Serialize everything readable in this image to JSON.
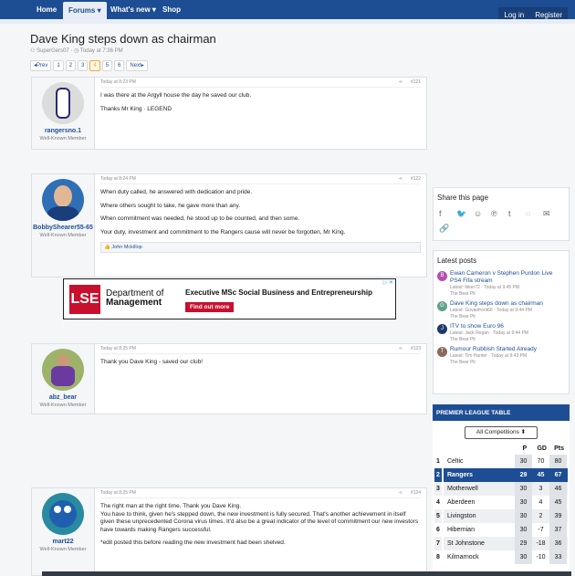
{
  "nav": {
    "home": "Home",
    "forums": "Forums",
    "whats_new": "What's new",
    "shop": "Shop",
    "login": "Log in",
    "register": "Register"
  },
  "thread": {
    "title": "Dave King steps down as chairman",
    "author": "SuperGers07",
    "date": "Today at 7:36 PM"
  },
  "pager": {
    "prev": "◂Prev",
    "pages": [
      "1",
      "2",
      "3",
      "4",
      "5",
      "6"
    ],
    "current": "4",
    "next": "Next▸"
  },
  "posts": [
    {
      "user": "rangersno.1",
      "title": "Well-Known Member",
      "time": "Today at 8:23 PM",
      "num": "#121",
      "body": [
        "I was there at the Argyll house the day he saved our club.",
        "Thanks Mr King · LEGEND"
      ]
    },
    {
      "user": "BobbyShearer55-65",
      "title": "Well-Known Member",
      "time": "Today at 8:24 PM",
      "num": "#122",
      "body": [
        "When duty called, he answered with dedication and pride.",
        "Where others sought to take, he gave more than any.",
        "When commitment was needed, he stood up to be counted, and then some.",
        "Your duty, investment and commitment to the Rangers cause will never be forgotten, Mr King."
      ],
      "likes": "John Mckillop"
    },
    {
      "user": "abz_bear",
      "title": "Well-Known Member",
      "time": "Today at 8:25 PM",
      "num": "#123",
      "body": [
        "Thank you Dave King - saved our club!"
      ]
    },
    {
      "user": "mart22",
      "title": "Well-Known Member",
      "time": "Today at 8:25 PM",
      "num": "#124",
      "body": [
        "The right man at the right time. Thank you Dave King.",
        "You have to think, given he's stepped down, the new investment is fully secured. That's another achievement in itself given these unprecedented Corona virus times. It'd also be a great indicator of the level of commitment our new investors have towards making Rangers successful.",
        "*edit posted this before reading the new investment had been shelved."
      ]
    }
  ],
  "ad": {
    "logo": "LSE",
    "dept1": "Department of",
    "dept2": "Management",
    "title": "Executive MSc Social Business and Entrepreneurship",
    "cta": "Find out more",
    "mark": "▷ ✕"
  },
  "share": {
    "title": "Share this page",
    "icons": [
      "facebook-icon",
      "twitter-icon",
      "reddit-icon",
      "pinterest-icon",
      "tumblr-icon",
      "whatsapp-icon",
      "email-icon",
      "link-icon"
    ]
  },
  "latest": {
    "title": "Latest posts",
    "items": [
      {
        "t": "Ewan Cameron v Stephen Purdon Live PS4 Fifa stream",
        "s": "Latest: biker72 · Today at 9:45 PM",
        "f": "The Bear Pit",
        "c": "#b44fb0",
        "i": "B"
      },
      {
        "t": "Dave King steps down as chairman",
        "s": "Latest: Govanfront66 · Today at 9:44 PM",
        "f": "The Bear Pit",
        "c": "#5fa28c",
        "i": "G"
      },
      {
        "t": "ITV to show Euro 96",
        "s": "Latest: Jack Regan · Today at 9:44 PM",
        "f": "The Bear Pit",
        "c": "#1d3a6e",
        "i": "J"
      },
      {
        "t": "Rumour Rubbish Started Already",
        "s": "Latest: Tim Hunter · Today at 9:43 PM",
        "f": "The Bear Pit",
        "c": "#8a6a5a",
        "i": "T"
      }
    ]
  },
  "table": {
    "title": "PREMIER LEAGUE TABLE",
    "select": "All Competitions",
    "cols": [
      "P",
      "GD",
      "Pts"
    ],
    "rows": [
      {
        "pos": "1",
        "team": "Celtic",
        "p": "30",
        "gd": "70",
        "pts": "80"
      },
      {
        "pos": "2",
        "team": "Rangers",
        "p": "29",
        "gd": "45",
        "pts": "67"
      },
      {
        "pos": "3",
        "team": "Motherwell",
        "p": "30",
        "gd": "3",
        "pts": "46"
      },
      {
        "pos": "4",
        "team": "Aberdeen",
        "p": "30",
        "gd": "4",
        "pts": "45"
      },
      {
        "pos": "5",
        "team": "Livingston",
        "p": "30",
        "gd": "2",
        "pts": "39"
      },
      {
        "pos": "6",
        "team": "Hibernian",
        "p": "30",
        "gd": "-7",
        "pts": "37"
      },
      {
        "pos": "7",
        "team": "St Johnstone",
        "p": "29",
        "gd": "-18",
        "pts": "36"
      },
      {
        "pos": "8",
        "team": "Kilmarnock",
        "p": "30",
        "gd": "-10",
        "pts": "33"
      }
    ]
  }
}
